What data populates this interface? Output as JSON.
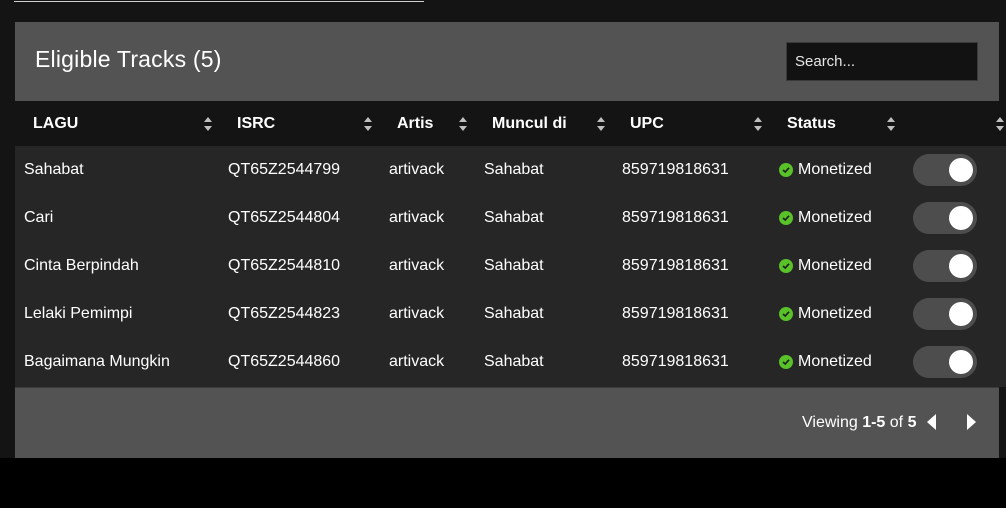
{
  "panel": {
    "title": "Eligible Tracks (5)",
    "search_placeholder": "Search..."
  },
  "table": {
    "columns": [
      "LAGU",
      "ISRC",
      "Artis",
      "Muncul di",
      "UPC",
      "Status",
      ""
    ],
    "rows": [
      {
        "lagu": "Sahabat",
        "isrc": "QT65Z2544799",
        "artis": "artivack",
        "muncul_di": "Sahabat",
        "upc": "859719818631",
        "status": "Monetized",
        "enabled": true
      },
      {
        "lagu": "Cari",
        "isrc": "QT65Z2544804",
        "artis": "artivack",
        "muncul_di": "Sahabat",
        "upc": "859719818631",
        "status": "Monetized",
        "enabled": true
      },
      {
        "lagu": "Cinta Berpindah",
        "isrc": "QT65Z2544810",
        "artis": "artivack",
        "muncul_di": "Sahabat",
        "upc": "859719818631",
        "status": "Monetized",
        "enabled": true
      },
      {
        "lagu": "Lelaki Pemimpi",
        "isrc": "QT65Z2544823",
        "artis": "artivack",
        "muncul_di": "Sahabat",
        "upc": "859719818631",
        "status": "Monetized",
        "enabled": true
      },
      {
        "lagu": "Bagaimana Mungkin",
        "isrc": "QT65Z2544860",
        "artis": "artivack",
        "muncul_di": "Sahabat",
        "upc": "859719818631",
        "status": "Monetized",
        "enabled": true
      }
    ]
  },
  "pager": {
    "prefix": "Viewing",
    "range": "1-5",
    "of_label": "of",
    "total": "5"
  },
  "colors": {
    "status_ok": "#59c229",
    "panel_bg": "#535353",
    "table_bg": "#262626",
    "header_bg": "#141414"
  }
}
